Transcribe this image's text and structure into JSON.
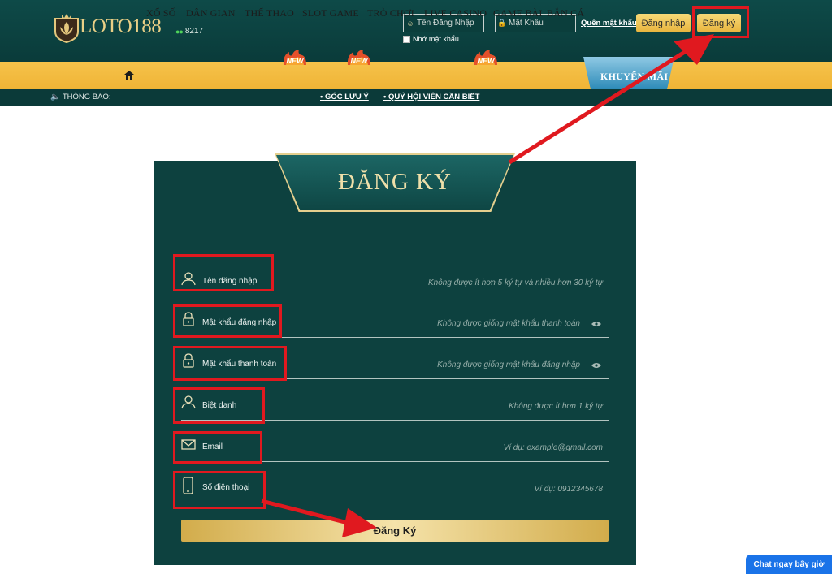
{
  "header": {
    "logo_text": "LOTO188",
    "online_count": "8217",
    "username_placeholder": "Tên Đăng Nhập",
    "password_placeholder": "Mật Khẩu",
    "remember_label": "Nhớ mật khẩu",
    "forgot_label": "Quên mật khẩu",
    "login_label": "Đăng nhập",
    "register_label": "Đăng ký"
  },
  "nav": {
    "items": [
      "XỔ SỐ",
      "DÂN GIAN",
      "THỂ THAO",
      "SLOT GAME",
      "TRÒ CHƠI",
      "LIVE CASINO",
      "GAME BÀI",
      "BẮN CÁ"
    ],
    "new_badge": "NEW",
    "promo_label": "KHUYẾN MÃI"
  },
  "notice": {
    "label": "THÔNG BÁO:",
    "links": [
      "GÓC LƯU Ý",
      "QUÝ HỘI VIÊN CẦN BIẾT"
    ]
  },
  "form": {
    "title": "ĐĂNG KÝ",
    "fields": [
      {
        "label": "Tên đăng nhập",
        "hint": "Không được ít hơn 5 ký tự và nhiều hơn 30 ký tự",
        "icon": "user-icon"
      },
      {
        "label": "Mật khẩu đăng nhập",
        "hint": "Không được giống mật khẩu thanh toán",
        "icon": "lock-icon"
      },
      {
        "label": "Mật khẩu thanh toán",
        "hint": "Không được giống mật khẩu đăng nhập",
        "icon": "lock-icon"
      },
      {
        "label": "Biệt danh",
        "hint": "Không được ít hơn 1 ký tự",
        "icon": "user-icon"
      },
      {
        "label": "Email",
        "hint": "Ví dụ: example@gmail.com",
        "icon": "mail-icon"
      },
      {
        "label": "Số điện thoại",
        "hint": "Ví dụ: 0912345678",
        "icon": "phone-icon"
      }
    ],
    "submit_label": "Đăng Ký"
  },
  "chat": {
    "label": "Chat ngay bây giờ"
  },
  "colors": {
    "panel": "#0d413f",
    "gold": "#e8b43d",
    "highlight": "#e0191f"
  }
}
